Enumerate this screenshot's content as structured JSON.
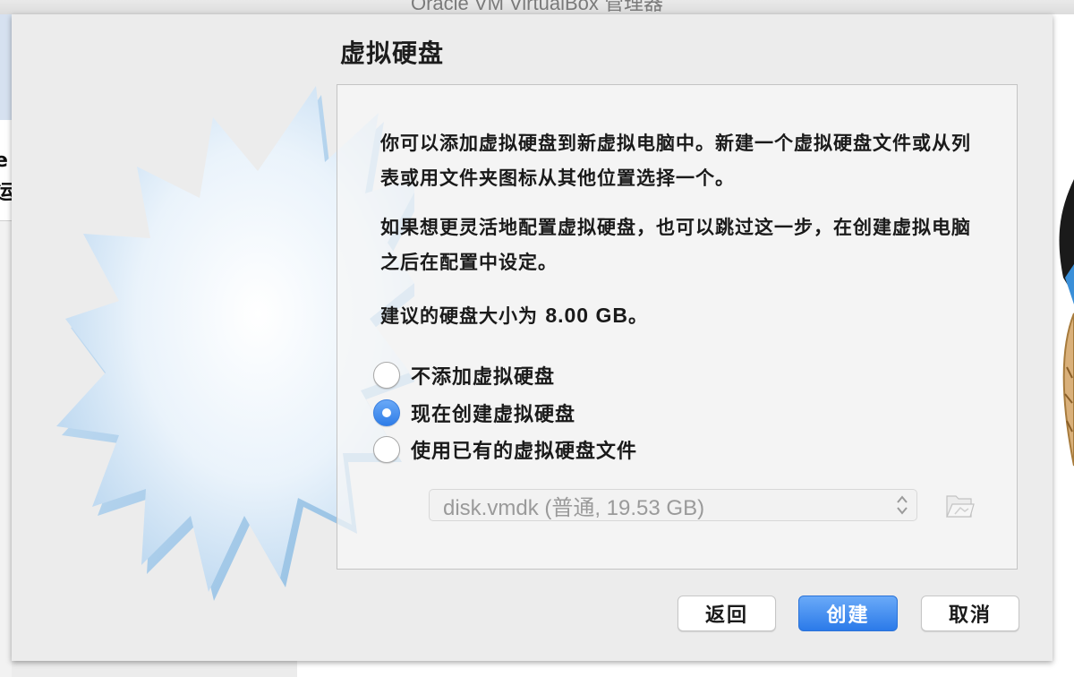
{
  "app": {
    "window_title": "Oracle VM VirtualBox 管理器",
    "sidebar_partial_text": "e\n运行"
  },
  "wizard": {
    "page_title": "虚拟硬盘",
    "paragraph1": "你可以添加虚拟硬盘到新虚拟电脑中。新建一个虚拟硬盘文件或从列表或用文件夹图标从其他位置选择一个。",
    "paragraph2": "如果想更灵活地配置虚拟硬盘，也可以跳过这一步，在创建虚拟电脑之后在配置中设定。",
    "recommendation_prefix": "建议的硬盘大小为 ",
    "recommendation_size": "8.00 GB",
    "recommendation_suffix": "。",
    "options": [
      {
        "label": "不添加虚拟硬盘",
        "checked": false
      },
      {
        "label": "现在创建虚拟硬盘",
        "checked": true
      },
      {
        "label": "使用已有的虚拟硬盘文件",
        "checked": false
      }
    ],
    "existing_disk_select": {
      "value": "disk.vmdk (普通, 19.53 GB)",
      "enabled": false
    },
    "icons": {
      "folder_button": "folder-open-icon",
      "select_arrows": "up-down-chevron-icon",
      "wizard_art": "starburst-art"
    },
    "buttons": {
      "back": "返回",
      "create": "创建",
      "cancel": "取消"
    }
  },
  "colors": {
    "accent": "#2f7de8",
    "dialog_background": "#ececec",
    "disabled_text": "#9a9a9a"
  }
}
